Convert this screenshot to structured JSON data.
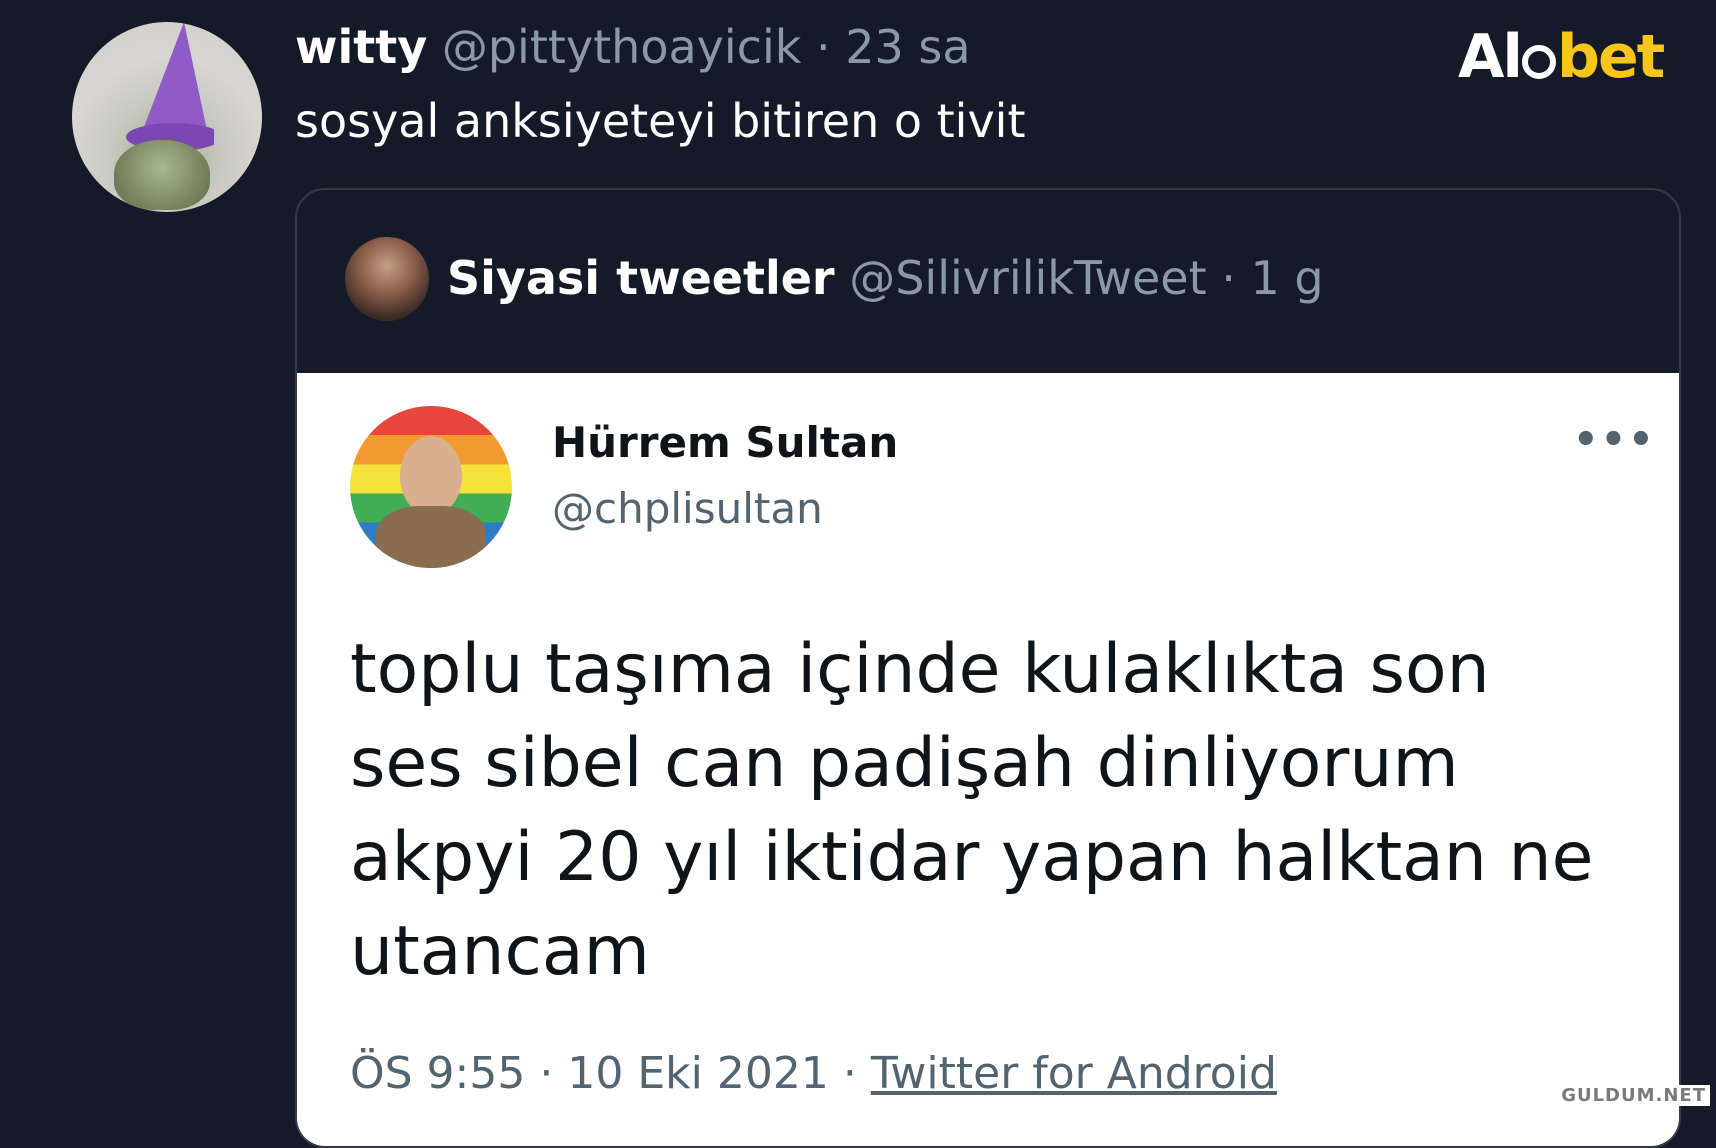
{
  "tweet": {
    "author_name": "witty",
    "author_handle": "@pittythoayicik",
    "separator": "·",
    "time": "23 sa",
    "text": "sosyal anksiyeteyi bitiren o tivit"
  },
  "logo": {
    "part1": "Al",
    "part2": "bet"
  },
  "quoted": {
    "author_name": "Siyasi tweetler",
    "author_handle": "@SilivrilikTweet",
    "separator": "·",
    "time": "1 g"
  },
  "screenshot_card": {
    "author_name": "Hürrem Sultan",
    "author_handle": "@chplisultan",
    "more": "•••",
    "text_lines": [
      "toplu taşıma içinde kulaklıkta son",
      "ses sibel can padişah dinliyorum",
      "akpyi 20 yıl iktidar yapan halktan ne",
      "utancam"
    ],
    "time": "ÖS 9:55",
    "separator1": "·",
    "date": "10 Eki 2021",
    "separator2": "·",
    "source": "Twitter for Android"
  },
  "watermark": "GULDUM.NET",
  "colors": {
    "background": "#141a27",
    "muted": "#8b98a5",
    "logo_yellow": "#f7c51c"
  }
}
